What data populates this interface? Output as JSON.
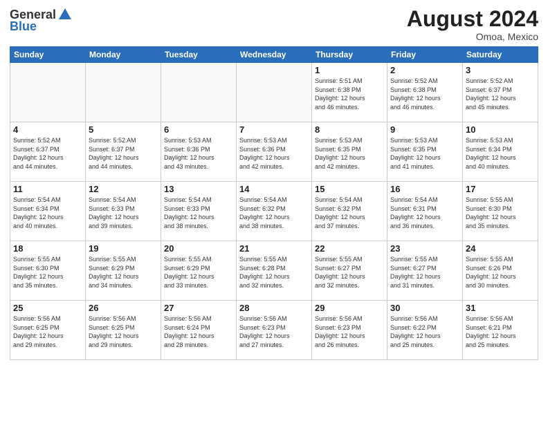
{
  "header": {
    "logo_general": "General",
    "logo_blue": "Blue",
    "month_year": "August 2024",
    "location": "Omoa, Mexico"
  },
  "days_of_week": [
    "Sunday",
    "Monday",
    "Tuesday",
    "Wednesday",
    "Thursday",
    "Friday",
    "Saturday"
  ],
  "weeks": [
    [
      {
        "day": "",
        "info": ""
      },
      {
        "day": "",
        "info": ""
      },
      {
        "day": "",
        "info": ""
      },
      {
        "day": "",
        "info": ""
      },
      {
        "day": "1",
        "info": "Sunrise: 5:51 AM\nSunset: 6:38 PM\nDaylight: 12 hours\nand 46 minutes."
      },
      {
        "day": "2",
        "info": "Sunrise: 5:52 AM\nSunset: 6:38 PM\nDaylight: 12 hours\nand 46 minutes."
      },
      {
        "day": "3",
        "info": "Sunrise: 5:52 AM\nSunset: 6:37 PM\nDaylight: 12 hours\nand 45 minutes."
      }
    ],
    [
      {
        "day": "4",
        "info": "Sunrise: 5:52 AM\nSunset: 6:37 PM\nDaylight: 12 hours\nand 44 minutes."
      },
      {
        "day": "5",
        "info": "Sunrise: 5:52 AM\nSunset: 6:37 PM\nDaylight: 12 hours\nand 44 minutes."
      },
      {
        "day": "6",
        "info": "Sunrise: 5:53 AM\nSunset: 6:36 PM\nDaylight: 12 hours\nand 43 minutes."
      },
      {
        "day": "7",
        "info": "Sunrise: 5:53 AM\nSunset: 6:36 PM\nDaylight: 12 hours\nand 42 minutes."
      },
      {
        "day": "8",
        "info": "Sunrise: 5:53 AM\nSunset: 6:35 PM\nDaylight: 12 hours\nand 42 minutes."
      },
      {
        "day": "9",
        "info": "Sunrise: 5:53 AM\nSunset: 6:35 PM\nDaylight: 12 hours\nand 41 minutes."
      },
      {
        "day": "10",
        "info": "Sunrise: 5:53 AM\nSunset: 6:34 PM\nDaylight: 12 hours\nand 40 minutes."
      }
    ],
    [
      {
        "day": "11",
        "info": "Sunrise: 5:54 AM\nSunset: 6:34 PM\nDaylight: 12 hours\nand 40 minutes."
      },
      {
        "day": "12",
        "info": "Sunrise: 5:54 AM\nSunset: 6:33 PM\nDaylight: 12 hours\nand 39 minutes."
      },
      {
        "day": "13",
        "info": "Sunrise: 5:54 AM\nSunset: 6:33 PM\nDaylight: 12 hours\nand 38 minutes."
      },
      {
        "day": "14",
        "info": "Sunrise: 5:54 AM\nSunset: 6:32 PM\nDaylight: 12 hours\nand 38 minutes."
      },
      {
        "day": "15",
        "info": "Sunrise: 5:54 AM\nSunset: 6:32 PM\nDaylight: 12 hours\nand 37 minutes."
      },
      {
        "day": "16",
        "info": "Sunrise: 5:54 AM\nSunset: 6:31 PM\nDaylight: 12 hours\nand 36 minutes."
      },
      {
        "day": "17",
        "info": "Sunrise: 5:55 AM\nSunset: 6:30 PM\nDaylight: 12 hours\nand 35 minutes."
      }
    ],
    [
      {
        "day": "18",
        "info": "Sunrise: 5:55 AM\nSunset: 6:30 PM\nDaylight: 12 hours\nand 35 minutes."
      },
      {
        "day": "19",
        "info": "Sunrise: 5:55 AM\nSunset: 6:29 PM\nDaylight: 12 hours\nand 34 minutes."
      },
      {
        "day": "20",
        "info": "Sunrise: 5:55 AM\nSunset: 6:29 PM\nDaylight: 12 hours\nand 33 minutes."
      },
      {
        "day": "21",
        "info": "Sunrise: 5:55 AM\nSunset: 6:28 PM\nDaylight: 12 hours\nand 32 minutes."
      },
      {
        "day": "22",
        "info": "Sunrise: 5:55 AM\nSunset: 6:27 PM\nDaylight: 12 hours\nand 32 minutes."
      },
      {
        "day": "23",
        "info": "Sunrise: 5:55 AM\nSunset: 6:27 PM\nDaylight: 12 hours\nand 31 minutes."
      },
      {
        "day": "24",
        "info": "Sunrise: 5:55 AM\nSunset: 6:26 PM\nDaylight: 12 hours\nand 30 minutes."
      }
    ],
    [
      {
        "day": "25",
        "info": "Sunrise: 5:56 AM\nSunset: 6:25 PM\nDaylight: 12 hours\nand 29 minutes."
      },
      {
        "day": "26",
        "info": "Sunrise: 5:56 AM\nSunset: 6:25 PM\nDaylight: 12 hours\nand 29 minutes."
      },
      {
        "day": "27",
        "info": "Sunrise: 5:56 AM\nSunset: 6:24 PM\nDaylight: 12 hours\nand 28 minutes."
      },
      {
        "day": "28",
        "info": "Sunrise: 5:56 AM\nSunset: 6:23 PM\nDaylight: 12 hours\nand 27 minutes."
      },
      {
        "day": "29",
        "info": "Sunrise: 5:56 AM\nSunset: 6:23 PM\nDaylight: 12 hours\nand 26 minutes."
      },
      {
        "day": "30",
        "info": "Sunrise: 5:56 AM\nSunset: 6:22 PM\nDaylight: 12 hours\nand 25 minutes."
      },
      {
        "day": "31",
        "info": "Sunrise: 5:56 AM\nSunset: 6:21 PM\nDaylight: 12 hours\nand 25 minutes."
      }
    ]
  ]
}
